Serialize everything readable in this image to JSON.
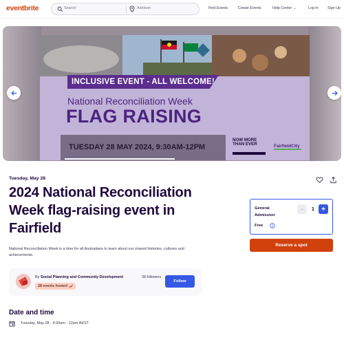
{
  "header": {
    "logo": "eventbrite",
    "search_placeholder": "Search",
    "location_placeholder": "Ashburn",
    "nav": [
      "Find Events",
      "Create Events",
      "Help Center",
      "Log In",
      "Sign Up"
    ],
    "brand_color": "#d1410c"
  },
  "banner": {
    "tag": "INCLUSIVE EVENT - ALL WELCOME!",
    "subtitle": "National Reconciliation Week",
    "title": "FLAG RAISING",
    "datetime": "TUESDAY 28 MAY 2024, 9:30AM-12PM",
    "theme_line1": "NOW MORE",
    "theme_line2": "THAN EVER",
    "council": "FairfieldCity",
    "accent_color": "#4a2380"
  },
  "event": {
    "date_line": "Tuesday, May 28",
    "title": "2024 National Reconciliation Week flag-raising event in Fairfield",
    "summary": "National Reconciliation Week is a time for all Australians to learn about our shared histories, cultures and achievements."
  },
  "organizer": {
    "by_prefix": "By",
    "name": "Social Planning and Community Development",
    "followers": "38 followers",
    "hosted": "28 events hosted",
    "follow_label": "Follow"
  },
  "ticket": {
    "name": "General Admission",
    "price": "Free",
    "quantity": "1",
    "minus_label": "−",
    "plus_label": "+",
    "reserve_label": "Reserve a spot",
    "accent_color": "#3659e3"
  },
  "date_and_time": {
    "heading": "Date and time",
    "value": "Tuesday, May 28 · 9:30am - 12pm AEST"
  }
}
